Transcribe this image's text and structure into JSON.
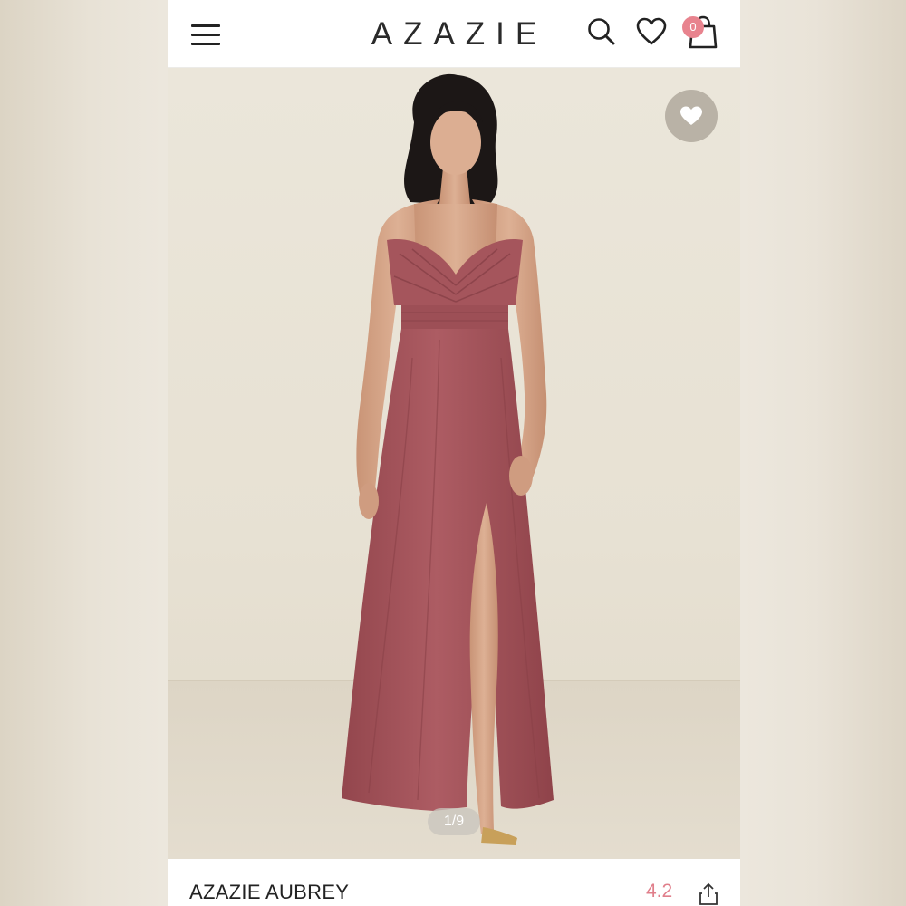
{
  "header": {
    "brand": "AZAZIE",
    "cart_count": "0"
  },
  "gallery": {
    "pager": "1/9"
  },
  "product": {
    "name": "AZAZIE AUBREY",
    "rating": "4.2"
  },
  "icons": {
    "menu": "hamburger-menu-icon",
    "search": "search-icon",
    "wishlist": "heart-outline-icon",
    "cart": "shopping-bag-icon",
    "favorite": "heart-filled-icon",
    "share": "share-icon"
  },
  "colors": {
    "accent": "#e8838e",
    "rating": "#e07f8b",
    "dress": "#a9565d"
  }
}
